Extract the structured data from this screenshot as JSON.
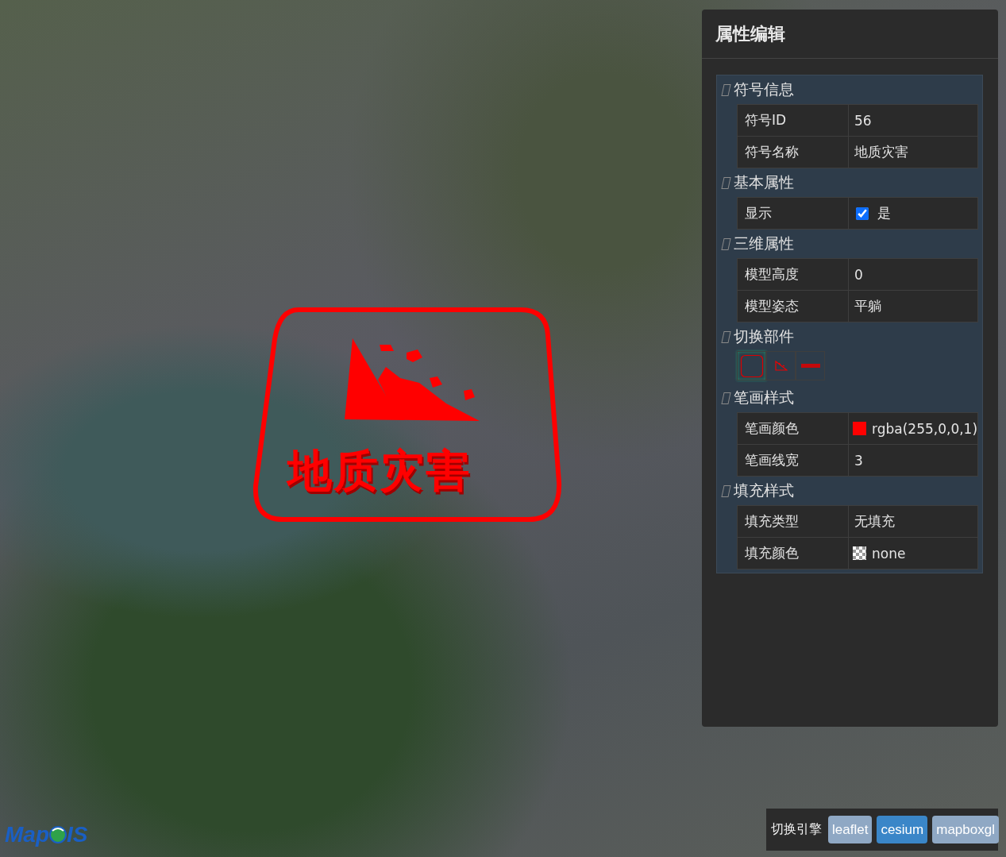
{
  "map": {
    "symbol_label": "地质灾害",
    "logo": {
      "left": "Map",
      "right": "IS"
    }
  },
  "panel": {
    "title": "属性编辑",
    "sections": [
      {
        "title": "符号信息",
        "kind": "table",
        "rows": [
          {
            "label": "符号ID",
            "kind": "text",
            "value": "56"
          },
          {
            "label": "符号名称",
            "kind": "text",
            "value": "地质灾害"
          }
        ]
      },
      {
        "title": "基本属性",
        "kind": "table",
        "rows": [
          {
            "label": "显示",
            "kind": "checkbox",
            "checked": true,
            "value": "是"
          }
        ]
      },
      {
        "title": "三维属性",
        "kind": "table",
        "rows": [
          {
            "label": "模型高度",
            "kind": "text",
            "value": "0"
          },
          {
            "label": "模型姿态",
            "kind": "text",
            "value": "平躺"
          }
        ]
      },
      {
        "title": "切换部件",
        "kind": "parts",
        "parts": [
          {
            "kind": "frame",
            "selected": true
          },
          {
            "kind": "mountain",
            "selected": false
          },
          {
            "kind": "label",
            "selected": false
          }
        ]
      },
      {
        "title": "笔画样式",
        "kind": "table",
        "rows": [
          {
            "label": "笔画颜色",
            "kind": "color",
            "color": "#ff0000",
            "value": "rgba(255,0,0,1)"
          },
          {
            "label": "笔画线宽",
            "kind": "text",
            "value": "3"
          }
        ]
      },
      {
        "title": "填充样式",
        "kind": "table",
        "rows": [
          {
            "label": "填充类型",
            "kind": "text",
            "value": "无填充"
          },
          {
            "label": "填充颜色",
            "kind": "pattern",
            "value": "none"
          }
        ]
      }
    ]
  },
  "engine_switch": {
    "label": "切换引擎",
    "engines": [
      {
        "label": "leaflet",
        "selected": false
      },
      {
        "label": "cesium",
        "selected": true
      },
      {
        "label": "mapboxgl",
        "selected": false
      }
    ]
  }
}
